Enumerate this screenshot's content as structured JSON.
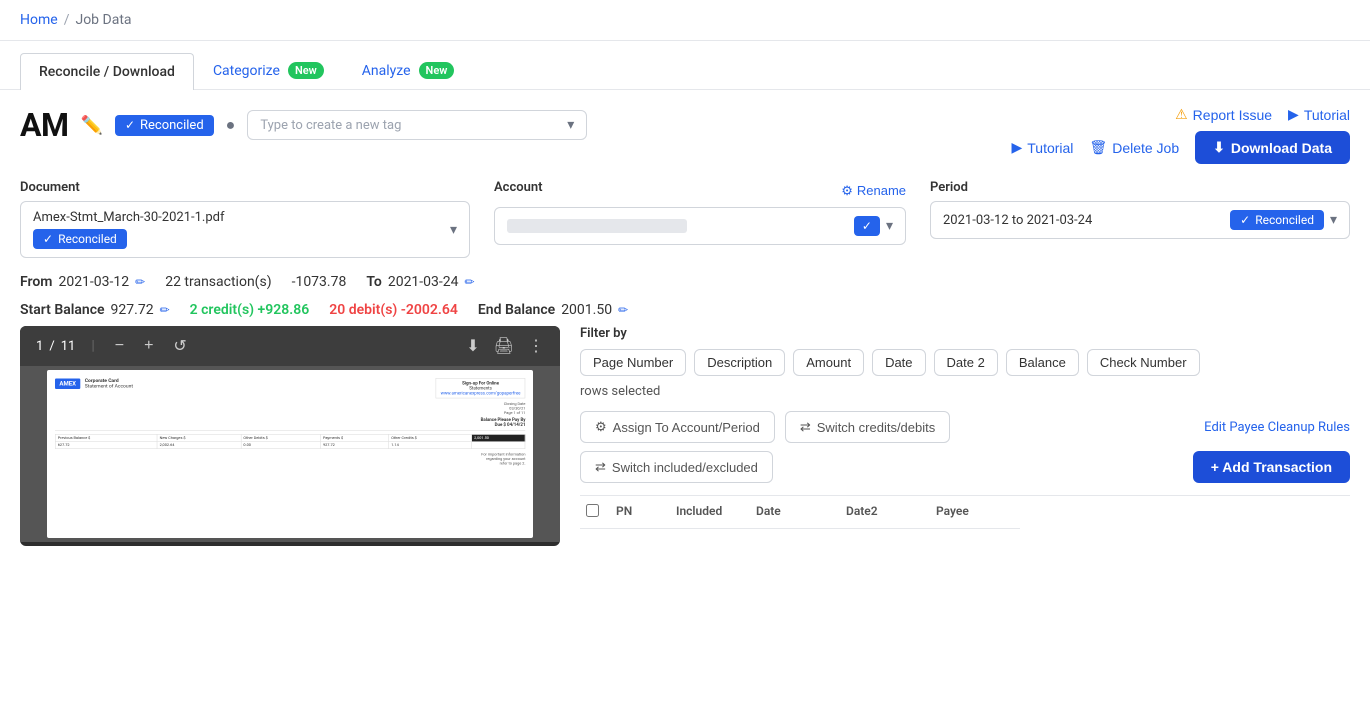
{
  "breadcrumb": {
    "home": "Home",
    "separator": "/",
    "current": "Job Data"
  },
  "tabs": [
    {
      "id": "reconcile",
      "label": "Reconcile / Download",
      "active": true,
      "badge": null
    },
    {
      "id": "categorize",
      "label": "Categorize",
      "active": false,
      "badge": "New"
    },
    {
      "id": "analyze",
      "label": "Analyze",
      "active": false,
      "badge": "New"
    }
  ],
  "header": {
    "job_title": "AM",
    "edit_icon": "✏",
    "reconciled_label": "Reconciled",
    "help_icon": "?",
    "tag_placeholder": "Type to create a new tag"
  },
  "top_actions": {
    "report_issue_label": "Report Issue",
    "tutorial_label": "Tutorial",
    "delete_job_label": "Delete Job",
    "download_data_label": "Download Data"
  },
  "document": {
    "label": "Document",
    "value": "Amex-Stmt_March-30-2021-1.pdf",
    "reconciled_badge": "Reconciled"
  },
  "account": {
    "label": "Account",
    "rename_label": "Rename",
    "value": ""
  },
  "period": {
    "label": "Period",
    "value": "2021-03-12 to 2021-03-24",
    "reconciled_badge": "Reconciled"
  },
  "stats": {
    "from_label": "From",
    "from_date": "2021-03-12",
    "transactions": "22 transaction(s)",
    "amount": "-1073.78",
    "to_label": "To",
    "to_date": "2021-03-24",
    "start_balance_label": "Start Balance",
    "start_balance": "927.72",
    "credits": "2 credit(s) +928.86",
    "debits": "20 debit(s) -2002.64",
    "end_balance_label": "End Balance",
    "end_balance": "2001.50"
  },
  "filter": {
    "label": "Filter by",
    "buttons": [
      "Page Number",
      "Description",
      "Amount",
      "Date",
      "Date 2",
      "Balance",
      "Check Number"
    ],
    "rows_selected": "rows selected"
  },
  "actions": {
    "assign_label": "Assign To Account/Period",
    "switch_credits_label": "Switch credits/debits",
    "switch_included_label": "Switch included/excluded",
    "edit_payee_label": "Edit Payee Cleanup Rules",
    "add_transaction_label": "+ Add Transaction"
  },
  "table": {
    "columns": [
      "",
      "PN",
      "Included",
      "Date",
      "Date2",
      "Payee"
    ]
  },
  "pdf": {
    "page_current": "1",
    "page_sep": "/",
    "page_total": "11"
  },
  "colors": {
    "blue": "#2563eb",
    "dark_blue": "#1d4ed8",
    "green": "#22c55e",
    "red": "#ef4444",
    "gray_border": "#d1d5db"
  }
}
